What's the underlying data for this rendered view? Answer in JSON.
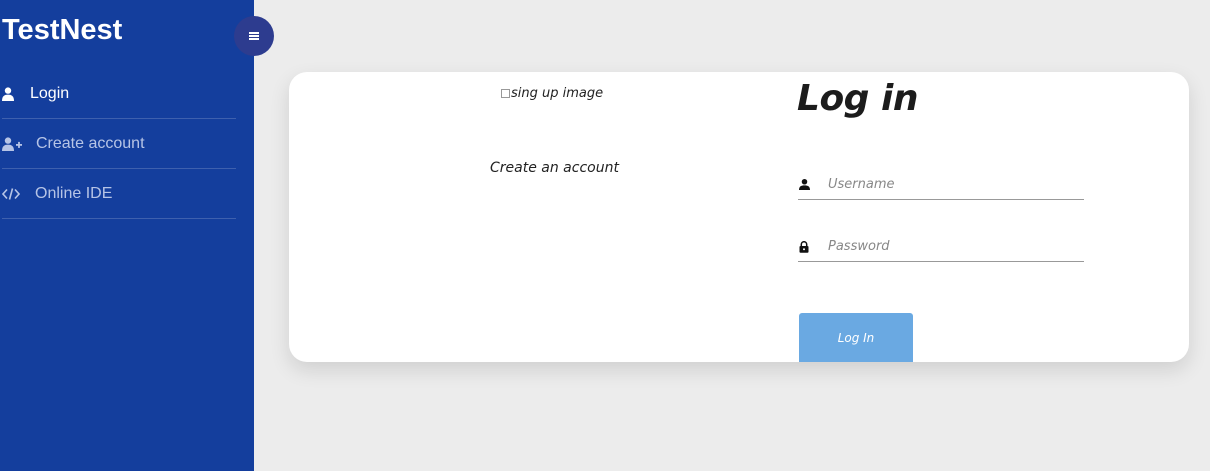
{
  "sidebar": {
    "brand": "TestNest",
    "toggle_icon": "menu-icon",
    "items": [
      {
        "label": "Login",
        "icon": "user-icon",
        "active": true
      },
      {
        "label": "Create account",
        "icon": "user-plus-icon",
        "active": false
      },
      {
        "label": "Online IDE",
        "icon": "code-icon",
        "active": false
      }
    ]
  },
  "card": {
    "image_alt": "sing up image",
    "create_link": "Create an account",
    "title": "Log in",
    "username_placeholder": "Username",
    "password_placeholder": "Password",
    "login_button": "Log In"
  },
  "colors": {
    "sidebar_bg": "#143e9d",
    "toggle_bg": "#2d3c8f",
    "page_bg": "#ececec",
    "button_bg": "#6aa9e2"
  }
}
